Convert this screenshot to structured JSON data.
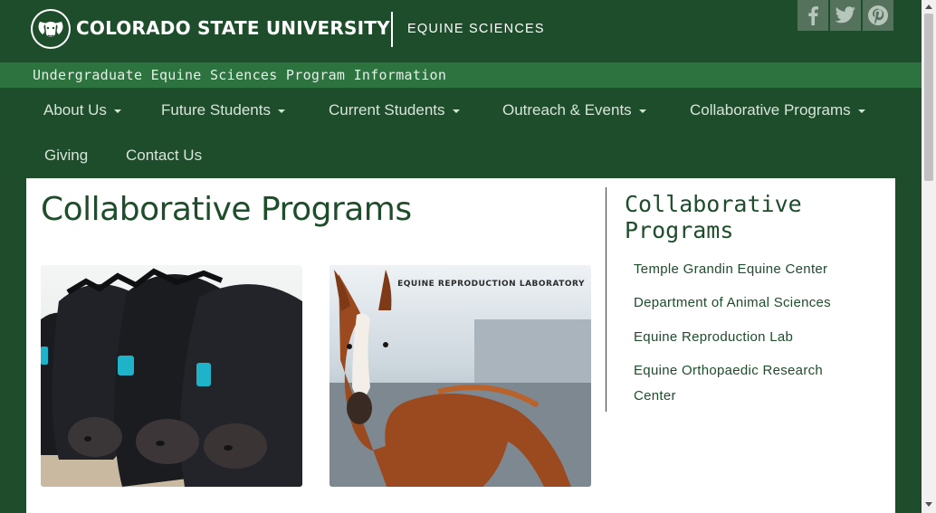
{
  "header": {
    "university": "COLORADO STATE UNIVERSITY",
    "department": "EQUINE SCIENCES",
    "logo_icon": "ram-head-logo",
    "social": [
      {
        "name": "facebook-icon"
      },
      {
        "name": "twitter-icon"
      },
      {
        "name": "pinterest-icon"
      }
    ]
  },
  "tagline": "Undergraduate Equine Sciences Program Information",
  "nav": {
    "items": [
      {
        "label": "About Us",
        "dropdown": true
      },
      {
        "label": "Future Students",
        "dropdown": true
      },
      {
        "label": "Current Students",
        "dropdown": true
      },
      {
        "label": "Outreach & Events",
        "dropdown": true
      },
      {
        "label": "Collaborative Programs",
        "dropdown": true
      },
      {
        "label": "Giving",
        "dropdown": false
      },
      {
        "label": "Contact Us",
        "dropdown": false
      }
    ]
  },
  "main": {
    "title": "Collaborative Programs",
    "cards": [
      {
        "name": "cattle-photo"
      },
      {
        "name": "foal-photo",
        "caption": "EQUINE REPRODUCTION LABORATORY"
      }
    ]
  },
  "sidebar": {
    "heading": "Collaborative Programs",
    "links": [
      "Temple Grandin Equine Center",
      "Department of Animal Sciences",
      "Equine Reproduction Lab",
      "Equine Orthopaedic Research Center"
    ]
  },
  "colors": {
    "csu_green": "#1e4d2b",
    "tagline_green": "#2d7340",
    "social_gray": "#55725c"
  }
}
